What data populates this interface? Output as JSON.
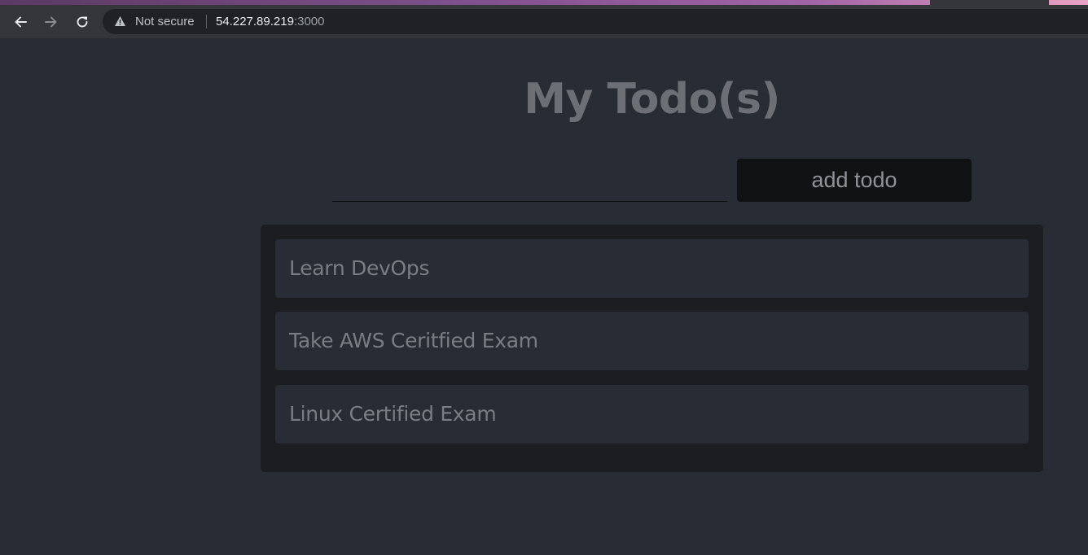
{
  "browser": {
    "security_label": "Not secure",
    "url_host": "54.227.89.219",
    "url_port": ":3000",
    "icons": [
      "back-arrow-icon",
      "forward-arrow-icon",
      "reload-icon",
      "warning-icon"
    ]
  },
  "app": {
    "title": "My Todo(s)",
    "input": {
      "value": "",
      "placeholder": ""
    },
    "add_button_label": "add todo",
    "todos": [
      {
        "text": "Learn DevOps"
      },
      {
        "text": "Take AWS Ceritfied Exam"
      },
      {
        "text": "Linux Certified Exam"
      }
    ]
  },
  "colors": {
    "page_background": "#282c34",
    "panel_background": "#1b1d21",
    "button_background": "#111214",
    "text_muted": "#7a7d84"
  }
}
